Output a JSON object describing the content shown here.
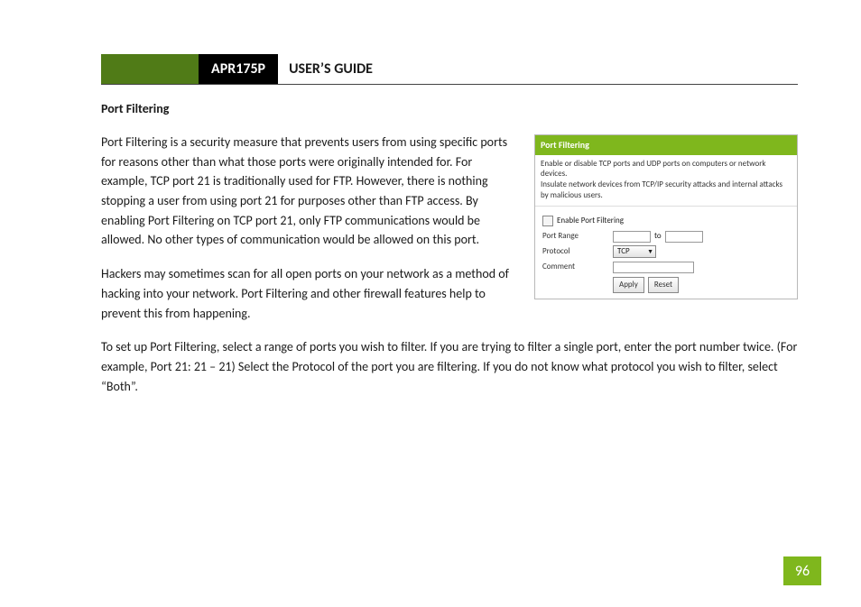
{
  "header": {
    "product_code": "APR175P",
    "guide_title": "USER’S GUIDE"
  },
  "section": {
    "heading": "Port Filtering",
    "para1": "Port Filtering is a security measure that prevents users from using specific ports for reasons other than what those ports were originally intended for.  For example, TCP port 21 is traditionally used for FTP.  However, there is nothing stopping a user from using port 21 for purposes other than FTP access.  By enabling Port Filtering on TCP port 21, only FTP communications would be allowed.  No other types of communication would be allowed on this port.",
    "para2": "Hackers may sometimes scan for all open ports on your network as a method of hacking into your network.  Port Filtering and other firewall features help to prevent this from happening.",
    "para3": "To set up Port Filtering, select a range of ports you wish to filter.  If you are trying to filter a single port, enter the port number twice.  (For example, Port 21:  21 – 21) Select the Protocol of the port you are filtering.  If you do not know what protocol you wish to filter, select “Both”."
  },
  "screenshot": {
    "title": "Port Filtering",
    "desc_line1": "Enable or disable TCP ports and UDP ports on computers or network devices.",
    "desc_line2": "Insulate network devices from TCP/IP security attacks and internal attacks by malicious users.",
    "enable_label": "Enable Port Filtering",
    "port_range_label": "Port Range",
    "to_label": "to",
    "protocol_label": "Protocol",
    "protocol_value": "TCP",
    "comment_label": "Comment",
    "apply_button": "Apply",
    "reset_button": "Reset"
  },
  "page_number": "96"
}
